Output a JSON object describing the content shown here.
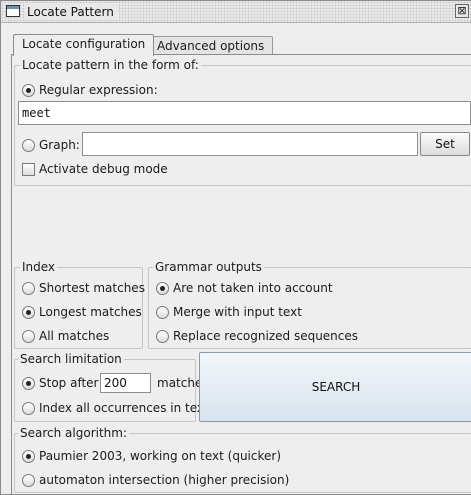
{
  "window": {
    "title": "Locate Pattern",
    "close_glyph": "⊠"
  },
  "tabs": [
    {
      "label": "Locate configuration",
      "active": true
    },
    {
      "label": "Advanced options",
      "active": false
    }
  ],
  "locate": {
    "legend": "Locate pattern in the form of:",
    "regex_label": "Regular expression:",
    "regex_selected": true,
    "regex_value": "meet",
    "graph_label": "Graph:",
    "graph_value": "",
    "set_label": "Set",
    "debug_label": "Activate debug mode",
    "debug_checked": false
  },
  "index": {
    "legend": "Index",
    "options": [
      {
        "label": "Shortest matches",
        "selected": false
      },
      {
        "label": "Longest matches",
        "selected": true
      },
      {
        "label": "All matches",
        "selected": false
      }
    ]
  },
  "grammar": {
    "legend": "Grammar outputs",
    "options": [
      {
        "label": "Are not taken into account",
        "selected": true
      },
      {
        "label": "Merge with input text",
        "selected": false
      },
      {
        "label": "Replace recognized sequences",
        "selected": false
      }
    ]
  },
  "limit": {
    "legend": "Search limitation",
    "stop_label": "Stop after",
    "stop_value": "200",
    "matches_label": "matches",
    "stop_selected": true,
    "all_label": "Index all occurrences in text",
    "all_selected": false
  },
  "search_label": "SEARCH",
  "algorithm": {
    "legend": "Search algorithm:",
    "options": [
      {
        "label": "Paumier 2003, working on text (quicker)",
        "selected": true
      },
      {
        "label": "automaton intersection (higher precision)",
        "selected": false
      }
    ]
  },
  "icons": {
    "window": "window-icon",
    "close": "close-icon"
  }
}
